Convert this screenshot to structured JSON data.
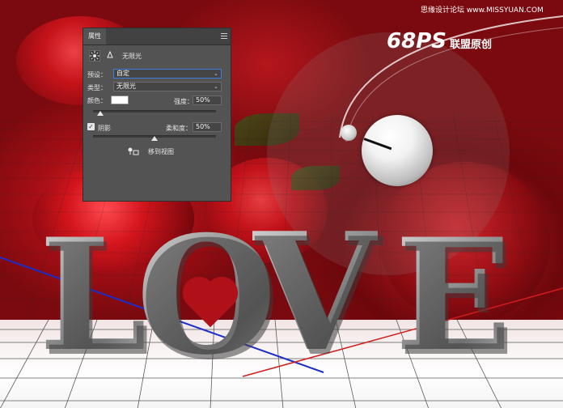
{
  "watermark": {
    "top_right": "思缘设计论坛 www.MISSYUAN.COM",
    "logo_number": "68",
    "logo_ps": "PS",
    "logo_text": "联盟原创"
  },
  "artwork": {
    "letters": [
      "L",
      "O",
      "V",
      "E"
    ]
  },
  "panel": {
    "tab_label": "属性",
    "light_type_heading": "无限光",
    "preset": {
      "label": "预设：",
      "value": "自定"
    },
    "type": {
      "label": "类型：",
      "value": "无限光"
    },
    "color": {
      "label": "颜色：",
      "value": "#ffffff"
    },
    "intensity": {
      "label": "强度：",
      "value": "50%",
      "slider": 0.06
    },
    "shadow": {
      "label": "阴影",
      "checked": true,
      "check_glyph": "✓"
    },
    "softness": {
      "label": "柔和度：",
      "value": "50%",
      "slider": 0.5
    },
    "move_to_view": "移到视图",
    "chevron": "⌄"
  },
  "colors": {
    "panel_bg": "#535353",
    "accent_blue": "#3d7fd8"
  },
  "icons": [
    "light-bulb-sun-icon",
    "light-spot-icon",
    "panel-menu-icon",
    "move-to-view-icon",
    "chevron-down-icon"
  ]
}
